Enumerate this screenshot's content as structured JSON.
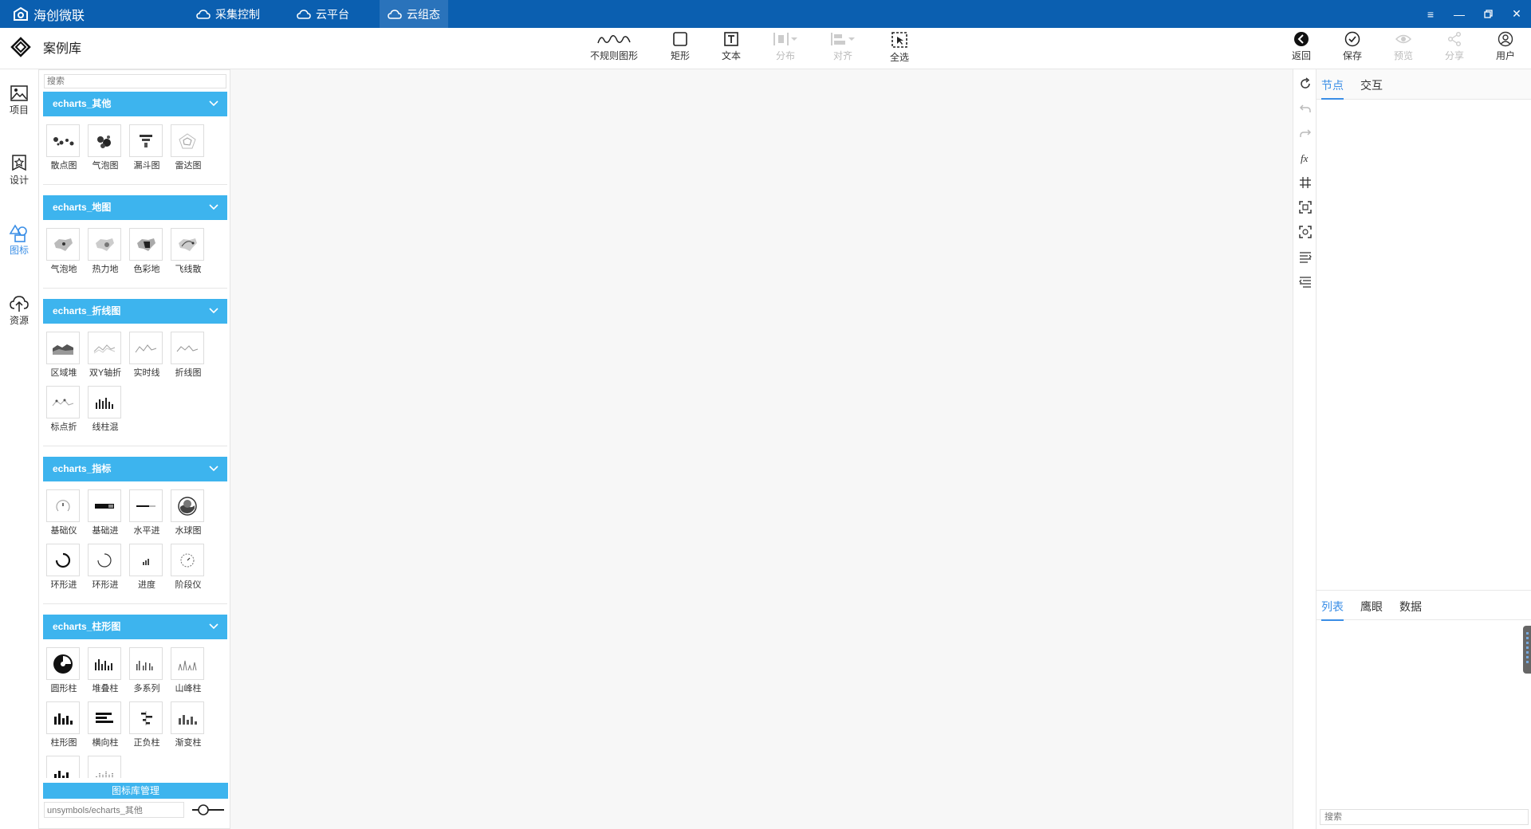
{
  "titlebar": {
    "app_name": "海创微联",
    "tabs": [
      {
        "label": "采集控制"
      },
      {
        "label": "云平台"
      },
      {
        "label": "云组态"
      }
    ]
  },
  "toolbar": {
    "page_title": "案例库",
    "tools": [
      {
        "label": "不规则图形",
        "icon": "wave-icon"
      },
      {
        "label": "矩形",
        "icon": "rectangle-icon"
      },
      {
        "label": "文本",
        "icon": "text-icon"
      },
      {
        "label": "分布",
        "icon": "distribute-icon",
        "disabled": true
      },
      {
        "label": "对齐",
        "icon": "align-icon",
        "disabled": true
      },
      {
        "label": "全选",
        "icon": "select-all-icon"
      }
    ],
    "actions": [
      {
        "label": "返回",
        "icon": "back-icon"
      },
      {
        "label": "保存",
        "icon": "save-check-icon"
      },
      {
        "label": "预览",
        "icon": "eye-icon",
        "disabled": true
      },
      {
        "label": "分享",
        "icon": "share-icon",
        "disabled": true
      },
      {
        "label": "用户",
        "icon": "user-icon"
      }
    ]
  },
  "leftnav": {
    "items": [
      {
        "label": "项目",
        "icon": "image-icon"
      },
      {
        "label": "设计",
        "icon": "design-icon"
      },
      {
        "label": "图标",
        "icon": "shapes-icon",
        "active": true
      },
      {
        "label": "资源",
        "icon": "cloud-upload-icon"
      }
    ]
  },
  "library": {
    "search_placeholder": "搜索",
    "categories": [
      {
        "name": "echarts_其他",
        "items": [
          "散点图",
          "气泡图",
          "漏斗图",
          "雷达图"
        ]
      },
      {
        "name": "echarts_地图",
        "items": [
          "气泡地",
          "热力地",
          "色彩地",
          "飞线散"
        ]
      },
      {
        "name": "echarts_折线图",
        "items": [
          "区域堆",
          "双Y轴折",
          "实时线",
          "折线图",
          "标点折",
          "线柱混"
        ]
      },
      {
        "name": "echarts_指标",
        "items": [
          "基础仪",
          "基础进",
          "水平进",
          "水球图",
          "环形进",
          "环形进",
          "进度",
          "阶段仪"
        ]
      },
      {
        "name": "echarts_柱形图",
        "items": [
          "圆形柱",
          "堆叠柱",
          "多系列",
          "山峰柱",
          "柱形图",
          "横向柱",
          "正负柱",
          "渐变柱",
          "",
          ""
        ]
      }
    ],
    "manage_label": "图标库管理",
    "path_value": "unsymbols/echarts_其他"
  },
  "rightpanel": {
    "top_tabs": [
      {
        "label": "节点",
        "active": true
      },
      {
        "label": "交互"
      }
    ],
    "bottom_tabs": [
      {
        "label": "列表",
        "active": true
      },
      {
        "label": "鹰眼"
      },
      {
        "label": "数据"
      }
    ],
    "search_placeholder": "搜索"
  },
  "colors": {
    "titlebar": "#0b5fb0",
    "category_header": "#3db4ee",
    "accent": "#3a8ee6",
    "canvas": "#f7f7f7"
  }
}
